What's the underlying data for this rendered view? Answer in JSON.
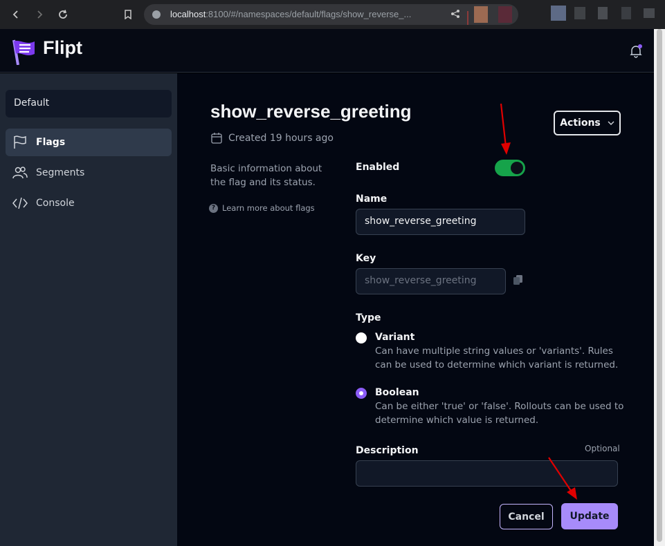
{
  "browser": {
    "url_host": "localhost",
    "url_rest": ":8100/#/namespaces/default/flags/show_reverse_..."
  },
  "app": {
    "name": "Flipt"
  },
  "sidebar": {
    "namespace": "Default",
    "items": [
      {
        "label": "Flags",
        "icon": "flag-icon",
        "active": true
      },
      {
        "label": "Segments",
        "icon": "users-icon",
        "active": false
      },
      {
        "label": "Console",
        "icon": "code-icon",
        "active": false
      }
    ]
  },
  "flag": {
    "title": "show_reverse_greeting",
    "created": "Created 19 hours ago",
    "actions_label": "Actions",
    "section_description": "Basic information about the flag and its status.",
    "learn_more": "Learn more about flags"
  },
  "form": {
    "enabled_label": "Enabled",
    "enabled": true,
    "name_label": "Name",
    "name_value": "show_reverse_greeting",
    "key_label": "Key",
    "key_value": "show_reverse_greeting",
    "type_label": "Type",
    "types": [
      {
        "title": "Variant",
        "desc": "Can have multiple string values or 'variants'. Rules can be used to determine which variant is returned.",
        "checked": false
      },
      {
        "title": "Boolean",
        "desc": "Can be either 'true' or 'false'. Rollouts can be used to determine which value is returned.",
        "checked": true
      }
    ],
    "description_label": "Description",
    "optional_label": "Optional",
    "description_value": "",
    "cancel_label": "Cancel",
    "update_label": "Update"
  },
  "colors": {
    "accent": "#a78bfa",
    "toggle_on": "#16a34a",
    "annotation_arrow": "#e00000"
  }
}
